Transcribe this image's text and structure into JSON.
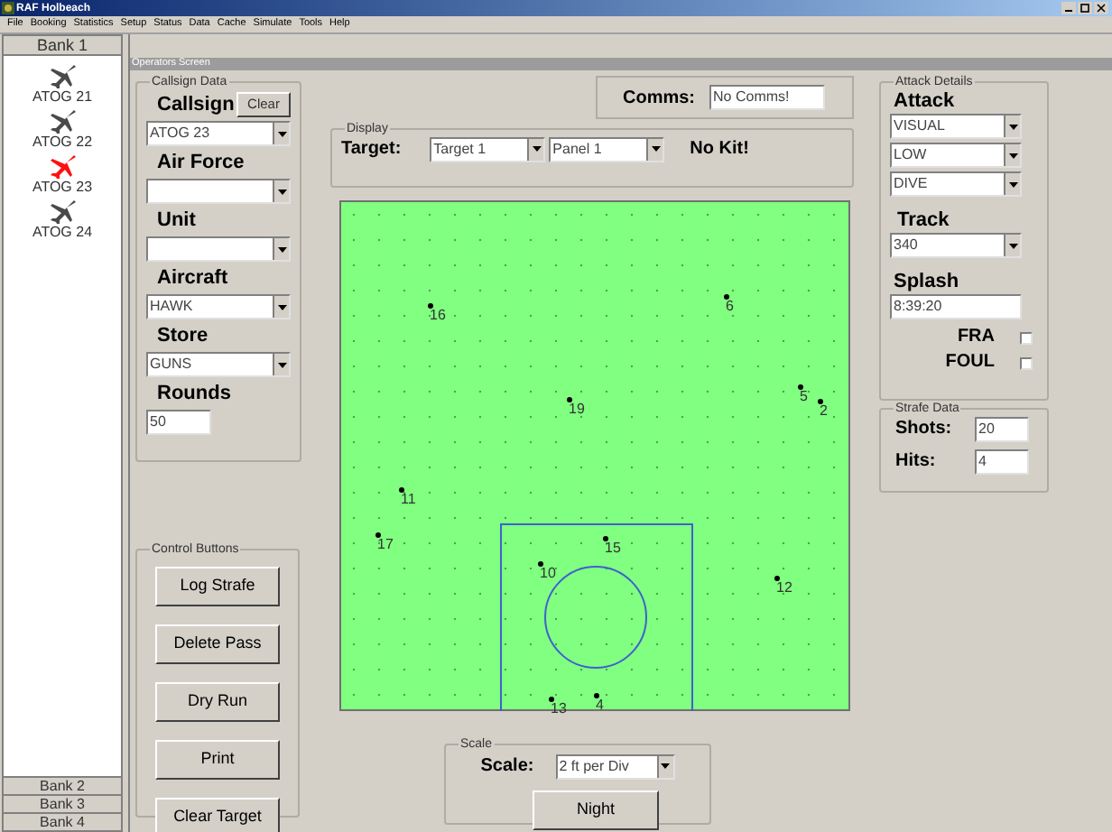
{
  "window": {
    "title": "RAF Holbeach"
  },
  "menu": [
    "File",
    "Booking",
    "Statistics",
    "Setup",
    "Status",
    "Data",
    "Cache",
    "Simulate",
    "Tools",
    "Help"
  ],
  "sidebar": {
    "bank": "Bank 1",
    "aircraft": [
      {
        "label": "ATOG 21",
        "selected": false
      },
      {
        "label": "ATOG 22",
        "selected": false
      },
      {
        "label": "ATOG 23",
        "selected": true
      },
      {
        "label": "ATOG 24",
        "selected": false
      }
    ],
    "other_banks": [
      "Bank 2",
      "Bank 3",
      "Bank 4"
    ]
  },
  "operators_screen": {
    "title": "Operators Screen"
  },
  "callsign_data": {
    "title": "Callsign Data",
    "clear_button": "Clear",
    "fields": [
      {
        "label": "Callsign",
        "value": "ATOG 23",
        "kind": "dropdown"
      },
      {
        "label": "Air Force",
        "kind": "dropdown"
      },
      {
        "label": "Unit",
        "kind": "dropdown"
      },
      {
        "label": "Aircraft",
        "value": "HAWK",
        "kind": "dropdown"
      },
      {
        "label": "Store",
        "value": "GUNS",
        "kind": "dropdown"
      },
      {
        "label": "Rounds",
        "value": "50",
        "kind": "text"
      }
    ]
  },
  "control_buttons": {
    "title": "Control Buttons",
    "buttons": [
      "Log Strafe",
      "Delete Pass",
      "Dry Run",
      "Print",
      "Clear Target"
    ]
  },
  "comms": {
    "label": "Comms:",
    "value": "No Comms!"
  },
  "display": {
    "title": "Display",
    "label": "Target:",
    "target": "Target 1",
    "panel": "Panel 1",
    "status": "No Kit!"
  },
  "target": {
    "hits": [
      {
        "label": "16"
      },
      {
        "label": "6"
      },
      {
        "label": "5"
      },
      {
        "label": "2"
      },
      {
        "label": "19"
      },
      {
        "label": "11"
      },
      {
        "label": "17"
      },
      {
        "label": "15"
      },
      {
        "label": "10"
      },
      {
        "label": "12"
      },
      {
        "label": "13"
      },
      {
        "label": "4"
      }
    ]
  },
  "scale": {
    "title": "Scale",
    "label": "Scale:",
    "value": "2 ft per Div",
    "button": "Night"
  },
  "attack_details": {
    "title": "Attack Details",
    "attack_label": "Attack",
    "attack": [
      "VISUAL",
      "LOW",
      "DIVE"
    ],
    "track_label": "Track",
    "track": "340",
    "splash_label": "Splash",
    "splash": "8:39:20",
    "checks": [
      {
        "label": "FRA",
        "checked": false
      },
      {
        "label": "FOUL",
        "checked": false
      }
    ]
  },
  "strafe_data": {
    "title": "Strafe Data",
    "rows": [
      {
        "label": "Shots:",
        "value": "20"
      },
      {
        "label": "Hits:",
        "value": "4"
      }
    ]
  }
}
